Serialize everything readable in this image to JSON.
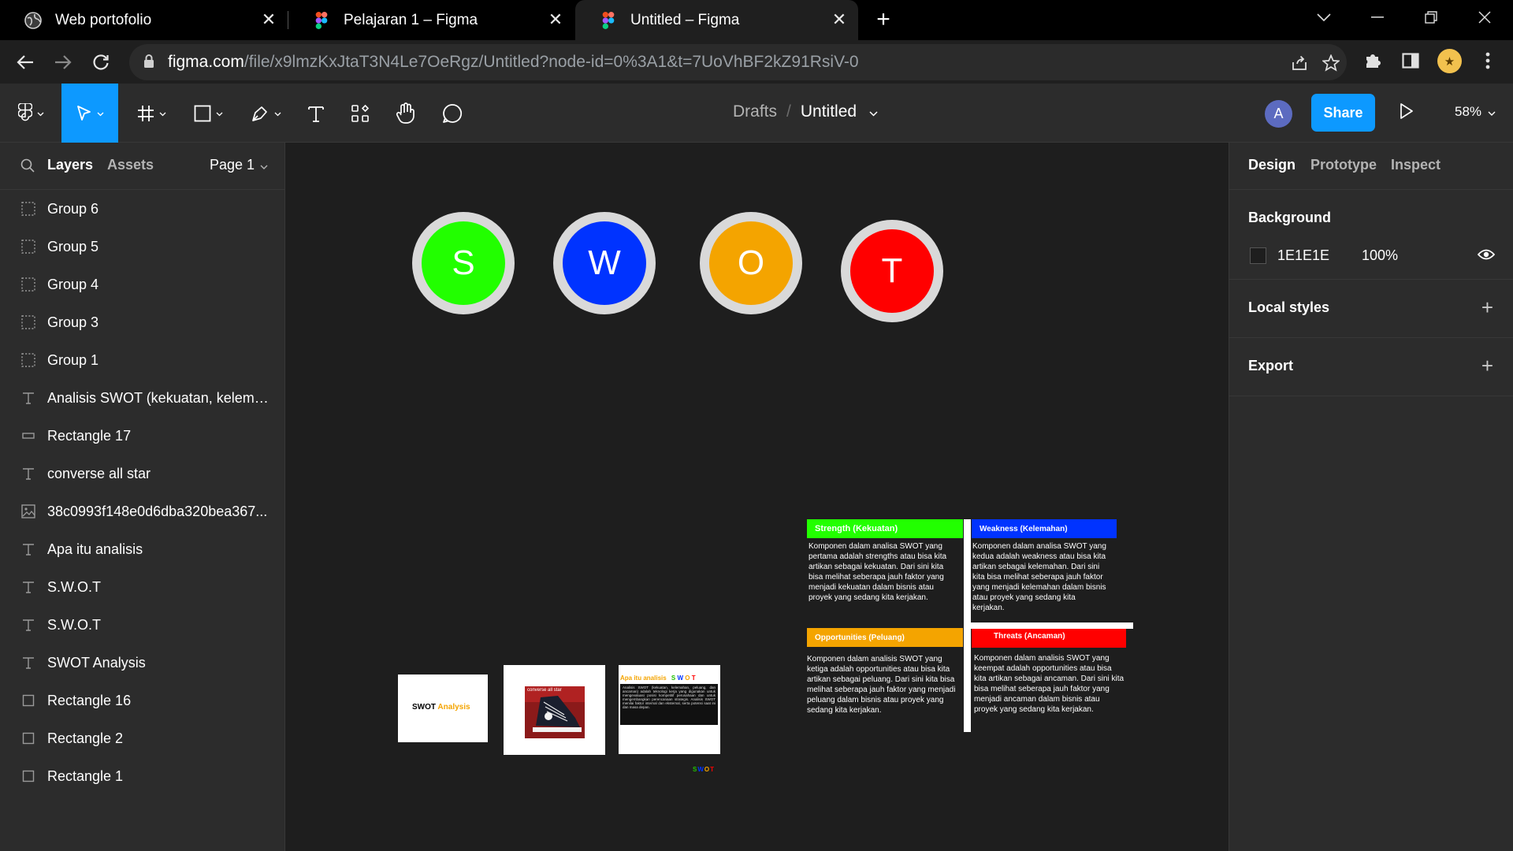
{
  "browser": {
    "tabs": [
      {
        "title": "Web portofolio",
        "active": false
      },
      {
        "title": "Pelajaran 1 – Figma",
        "active": false
      },
      {
        "title": "Untitled – Figma",
        "active": true
      }
    ],
    "url_host": "figma.com",
    "url_path": "/file/x9lmzKxJtaT3N4Le7OeRgz/Untitled?node-id=0%3A1&t=7UoVhBF2kZ91RsiV-0"
  },
  "toolbar": {
    "breadcrumb_drafts": "Drafts",
    "breadcrumb_sep": "/",
    "file_name": "Untitled",
    "avatar_initial": "A",
    "share_label": "Share",
    "zoom": "58%",
    "accent": "#0d99ff"
  },
  "left_panel": {
    "tab_layers": "Layers",
    "tab_assets": "Assets",
    "page": "Page 1",
    "layers": [
      {
        "name": "Group 6",
        "icon": "group-icon"
      },
      {
        "name": "Group 5",
        "icon": "group-icon"
      },
      {
        "name": "Group 4",
        "icon": "group-icon"
      },
      {
        "name": "Group 3",
        "icon": "group-icon"
      },
      {
        "name": "Group 1",
        "icon": "group-icon"
      },
      {
        "name": "Analisis SWOT (kekuatan, kelemah...",
        "icon": "text-icon"
      },
      {
        "name": "Rectangle 17",
        "icon": "rectangle-icon"
      },
      {
        "name": "converse all star",
        "icon": "text-icon"
      },
      {
        "name": "38c0993f148e0d6dba320bea367...",
        "icon": "image-icon"
      },
      {
        "name": "Apa itu analisis",
        "icon": "text-icon"
      },
      {
        "name": "S.W.O.T",
        "icon": "text-icon"
      },
      {
        "name": "S.W.O.T",
        "icon": "text-icon"
      },
      {
        "name": "SWOT Analysis",
        "icon": "text-icon"
      },
      {
        "name": "Rectangle 16",
        "icon": "frame-icon"
      },
      {
        "name": "Rectangle 2",
        "icon": "frame-icon"
      },
      {
        "name": "Rectangle 1",
        "icon": "frame-icon"
      }
    ]
  },
  "canvas": {
    "circles": [
      {
        "letter": "S",
        "color": "#22ff00"
      },
      {
        "letter": "W",
        "color": "#0033ff"
      },
      {
        "letter": "O",
        "color": "#f4a400"
      },
      {
        "letter": "T",
        "color": "#ff0000"
      }
    ],
    "frame1": {
      "title_a": "SWOT",
      "title_b": "Analysis"
    },
    "frame2": {
      "caption": "converse all star"
    },
    "frame3": {
      "head": "Apa itu analisis",
      "swot_letters": [
        "S",
        "W",
        "O",
        "T"
      ],
      "body": "Analisis SWOT (kekuatan, kelemahan, peluang, dan ancaman) adalah teknologi kerja yang digunakan untuk mengevaluasi posisi kompetitif perusahaan dan untuk mengembangkan perencanaan strategis. Analisis SWOT menilai faktor internal dan eksternal, serta potensi saat ini dan masa depan."
    },
    "mini_swot": [
      "S",
      "W",
      "O",
      "T"
    ],
    "quadrants": {
      "strength": {
        "title": "Strength (Kekuatan)",
        "color": "#22ff00",
        "text": "Komponen dalam analisa SWOT yang pertama adalah strengths atau bisa kita artikan sebagai kekuatan. Dari sini kita bisa melihat seberapa jauh faktor yang menjadi kekuatan dalam bisnis atau proyek yang sedang kita kerjakan."
      },
      "weakness": {
        "title": "Weakness (Kelemahan)",
        "color": "#0033ff",
        "text": "Komponen dalam analisa SWOT yang kedua adalah weakness atau bisa kita artikan sebagai kelemahan. Dari sini kita bisa melihat seberapa jauh faktor yang menjadi kelemahan dalam bisnis atau proyek yang sedang kita kerjakan."
      },
      "opportunities": {
        "title": "Opportunities (Peluang)",
        "color": "#f4a400",
        "text": "Komponen dalam analisis SWOT yang ketiga adalah opportunities atau bisa kita artikan sebagai peluang. Dari sini kita bisa melihat seberapa jauh faktor yang menjadi peluang dalam bisnis atau proyek yang sedang kita kerjakan."
      },
      "threats": {
        "title": "Threats (Ancaman)",
        "color": "#ff0000",
        "text": "Komponen dalam analisis SWOT yang keempat adalah opportunities atau bisa kita artikan sebagai ancaman. Dari sini kita bisa melihat seberapa jauh faktor yang menjadi ancaman dalam bisnis atau proyek yang sedang kita kerjakan."
      }
    },
    "help": "?"
  },
  "right_panel": {
    "tab_design": "Design",
    "tab_prototype": "Prototype",
    "tab_inspect": "Inspect",
    "background_title": "Background",
    "background_hex": "1E1E1E",
    "background_opacity": "100%",
    "local_styles": "Local styles",
    "export": "Export"
  }
}
